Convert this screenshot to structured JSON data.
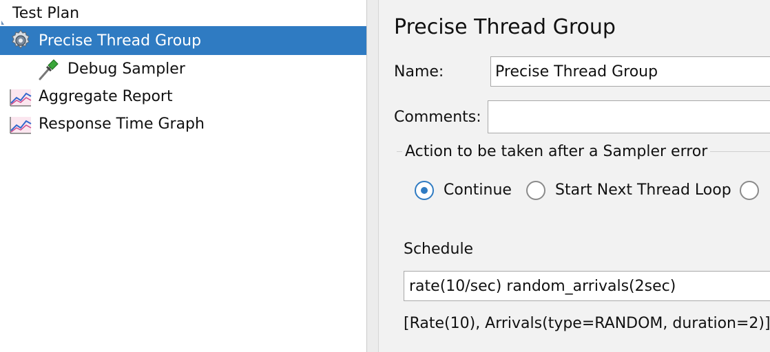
{
  "tree": {
    "root": {
      "label": "Test Plan",
      "icon": "test-plan-icon"
    },
    "items": [
      {
        "label": "Precise Thread Group",
        "icon": "gear-icon",
        "selected": true
      },
      {
        "label": "Debug Sampler",
        "icon": "pipette-icon",
        "selected": false
      },
      {
        "label": "Aggregate Report",
        "icon": "graph-icon",
        "selected": false
      },
      {
        "label": "Response Time Graph",
        "icon": "graph-icon",
        "selected": false
      }
    ]
  },
  "panel": {
    "title": "Precise Thread Group",
    "name_label": "Name:",
    "name_value": "Precise Thread Group",
    "comments_label": "Comments:",
    "comments_value": "",
    "action_legend": "Action to be taken after a Sampler error",
    "radios": [
      {
        "label": "Continue",
        "checked": true
      },
      {
        "label": "Start Next Thread Loop",
        "checked": false
      }
    ],
    "schedule_label": "Schedule",
    "schedule_value": "rate(10/sec) random_arrivals(2sec)",
    "schedule_parsed": "[Rate(10), Arrivals(type=RANDOM, duration=2)]"
  },
  "colors": {
    "selection": "#2f7bc2",
    "tree_bg": "#ffffff",
    "panel_bg": "#f2f2f2"
  }
}
